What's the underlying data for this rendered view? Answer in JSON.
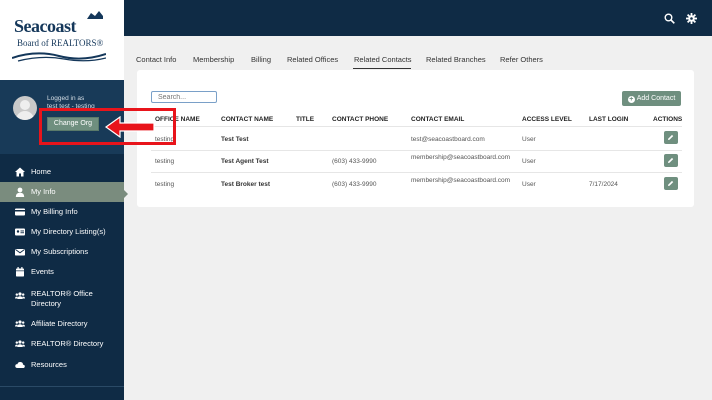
{
  "logo": {
    "title": "Seacoast",
    "subtitle": "Board of REALTORS®"
  },
  "user": {
    "logged_in_label": "Logged in as",
    "name": "test test - testing",
    "change_org_label": "Change Org"
  },
  "sidebar": {
    "items": [
      {
        "label": "Home",
        "icon": "home-icon"
      },
      {
        "label": "My Info",
        "icon": "user-icon",
        "active": true
      },
      {
        "label": "My Billing Info",
        "icon": "credit-card-icon"
      },
      {
        "label": "My Directory Listing(s)",
        "icon": "id-card-icon"
      },
      {
        "label": "My Subscriptions",
        "icon": "envelope-icon"
      },
      {
        "label": "Events",
        "icon": "calendar-icon"
      },
      {
        "label": "REALTOR® Office Directory",
        "icon": "users-icon"
      },
      {
        "label": "Affiliate Directory",
        "icon": "users-icon"
      },
      {
        "label": "REALTOR® Directory",
        "icon": "users-icon"
      },
      {
        "label": "Resources",
        "icon": "cloud-icon"
      }
    ]
  },
  "topbar": {
    "icons": [
      "search-icon",
      "gear-icon"
    ]
  },
  "tabs": [
    {
      "label": "Contact Info"
    },
    {
      "label": "Membership"
    },
    {
      "label": "Billing"
    },
    {
      "label": "Related Offices"
    },
    {
      "label": "Related Contacts",
      "active": true
    },
    {
      "label": "Related Branches"
    },
    {
      "label": "Refer Others"
    }
  ],
  "table": {
    "search_placeholder": "Search...",
    "add_contact_label": "Add Contact",
    "headers": [
      "OFFICE NAME",
      "CONTACT NAME",
      "TITLE",
      "CONTACT PHONE",
      "CONTACT EMAIL",
      "ACCESS LEVEL",
      "LAST LOGIN",
      "ACTIONS"
    ],
    "rows": [
      {
        "office": "testing",
        "contact": "Test Test",
        "title": "",
        "phone": "",
        "email": "test@seacoastboard.com",
        "access": "User",
        "last_login": ""
      },
      {
        "office": "testing",
        "contact": "Test Agent Test",
        "title": "",
        "phone": "(603) 433-9990",
        "email": "membership@seacoastboard.com",
        "access": "User",
        "last_login": ""
      },
      {
        "office": "testing",
        "contact": "Test Broker test",
        "title": "",
        "phone": "(603) 433-9990",
        "email": "membership@seacoastboard.com",
        "access": "User",
        "last_login": "7/17/2024"
      }
    ]
  },
  "colors": {
    "sidebar_bg": "#0f2b45",
    "accent_green": "#6f8f7f",
    "annotation_red": "#e8141b"
  }
}
